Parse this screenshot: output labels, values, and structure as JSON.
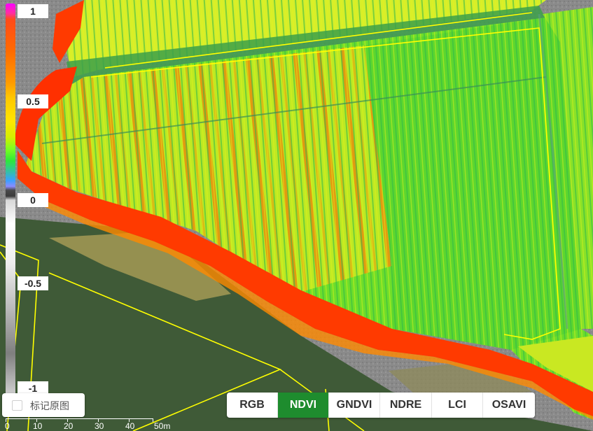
{
  "map": {
    "legend": {
      "ticks": [
        "1",
        "0.5",
        "0",
        "-0.5",
        "-1"
      ]
    },
    "mark_original": {
      "label": "标记原图",
      "checked": false
    },
    "indices": {
      "items": [
        "RGB",
        "NDVI",
        "GNDVI",
        "NDRE",
        "LCI",
        "OSAVI"
      ],
      "selected": "NDVI"
    },
    "scale": {
      "labels": [
        "0",
        "10",
        "20",
        "30",
        "40",
        "50m"
      ]
    },
    "colors": {
      "field_green": "#4fd62a",
      "field_yellow": "#e6f000",
      "field_red": "#ff2a00",
      "boundary_yellow": "#ffff00",
      "active_button": "#1e8c2e"
    }
  }
}
